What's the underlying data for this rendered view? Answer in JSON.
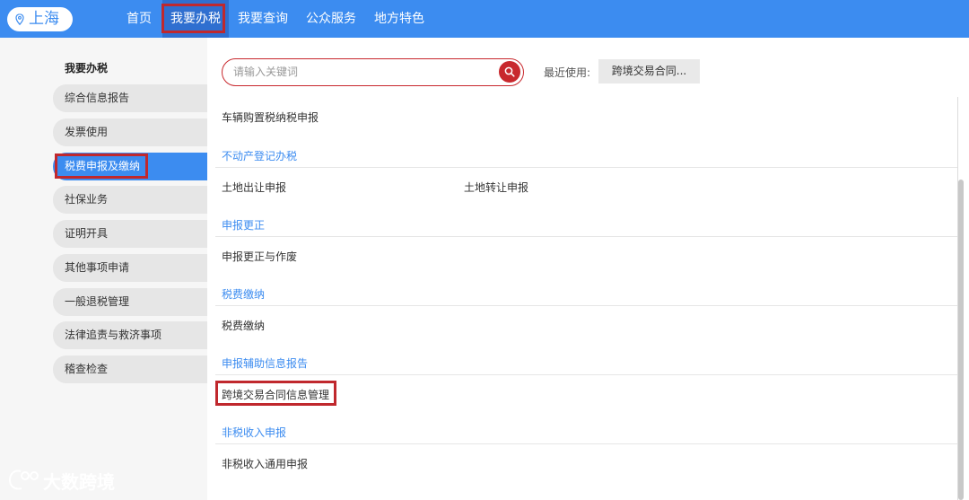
{
  "location": {
    "city": "上海",
    "icon": "location-pin-icon"
  },
  "nav": {
    "items": [
      "首页",
      "我要办税",
      "我要查询",
      "公众服务",
      "地方特色"
    ],
    "active": "我要办税"
  },
  "sidebar": {
    "title": "我要办税",
    "items": [
      "综合信息报告",
      "发票使用",
      "税费申报及缴纳",
      "社保业务",
      "证明开具",
      "其他事项申请",
      "一般退税管理",
      "法律追责与救济事项",
      "稽查检查"
    ],
    "active": "税费申报及缴纳"
  },
  "search": {
    "placeholder": "请输入关键词",
    "icon": "search-icon"
  },
  "recent": {
    "label": "最近使用:",
    "chip": "跨境交易合同..."
  },
  "content": {
    "item_vehicle": "车辆购置税纳税申报",
    "cat_realestate": "不动产登记办税",
    "item_land_out": "土地出让申报",
    "item_land_transfer": "土地转让申报",
    "cat_correction": "申报更正",
    "item_correction": "申报更正与作废",
    "cat_payment": "税费缴纳",
    "item_payment": "税费缴纳",
    "cat_aux": "申报辅助信息报告",
    "item_crossborder": "跨境交易合同信息管理",
    "cat_nontax": "非税收入申报",
    "item_nontax": "非税收入通用申报"
  },
  "watermark": {
    "text": "大数跨境"
  },
  "colors": {
    "brand_blue": "#3c8cf0",
    "highlight_red": "#c0282d",
    "category_blue": "#3c8cf0"
  }
}
